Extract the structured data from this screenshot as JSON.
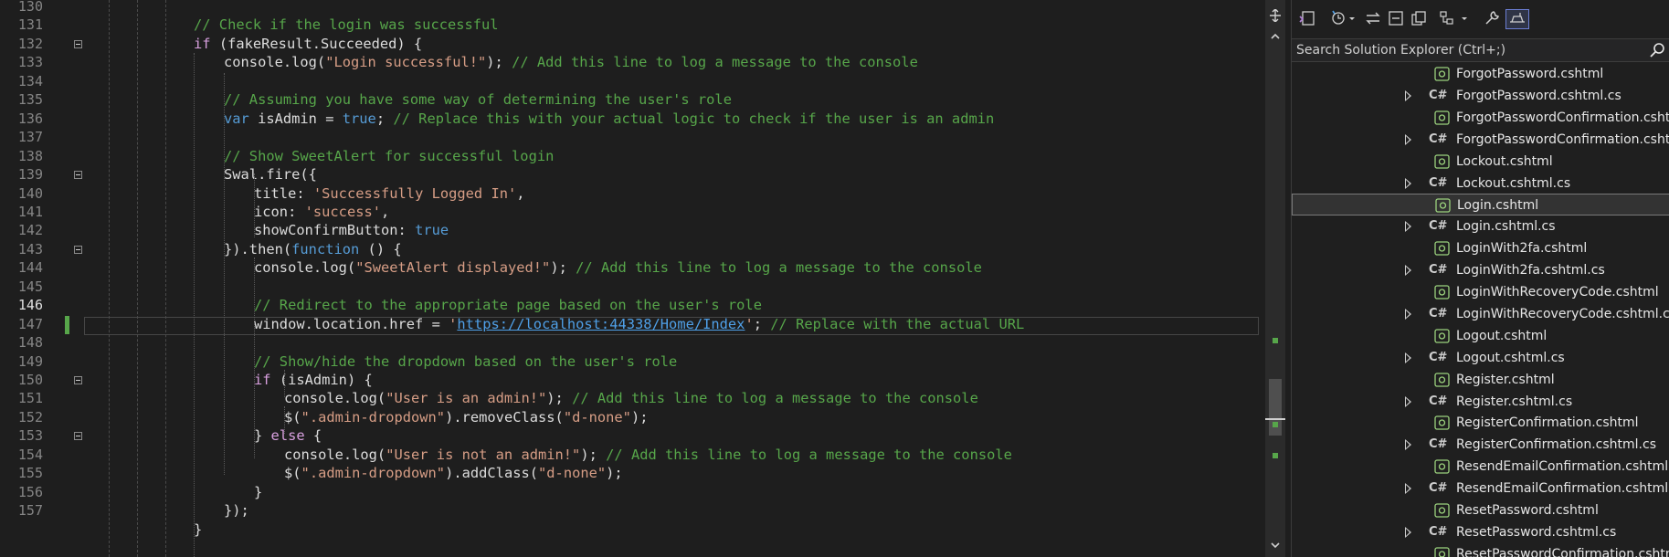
{
  "editor": {
    "line_numbers": [
      "130",
      "131",
      "132",
      "133",
      "134",
      "135",
      "136",
      "137",
      "138",
      "139",
      "140",
      "141",
      "142",
      "143",
      "144",
      "145",
      "146",
      "147",
      "148",
      "149",
      "150",
      "151",
      "152",
      "153",
      "154",
      "155",
      "156",
      "157"
    ],
    "current_line": "146",
    "lines": [
      [],
      [
        {
          "t": "// Check if the login was successful",
          "c": "cm"
        }
      ],
      [
        {
          "t": "if",
          "c": "ct"
        },
        {
          "t": " (fakeResult.Succeeded) {",
          "c": "id"
        }
      ],
      [
        {
          "t": "console.log(",
          "c": "id"
        },
        {
          "t": "\"Login successful!\"",
          "c": "str"
        },
        {
          "t": "); ",
          "c": "id"
        },
        {
          "t": "// Add this line to log a message to the console",
          "c": "cm"
        }
      ],
      [],
      [
        {
          "t": "// Assuming you have some way of determining the user's role",
          "c": "cm"
        }
      ],
      [
        {
          "t": "var",
          "c": "kw"
        },
        {
          "t": " isAdmin = ",
          "c": "id"
        },
        {
          "t": "true",
          "c": "kw"
        },
        {
          "t": "; ",
          "c": "id"
        },
        {
          "t": "// Replace this with your actual logic to check if the user is an admin",
          "c": "cm"
        }
      ],
      [],
      [
        {
          "t": "// Show SweetAlert for successful login",
          "c": "cm"
        }
      ],
      [
        {
          "t": "Swal.fire({",
          "c": "id"
        }
      ],
      [
        {
          "t": "title: ",
          "c": "id"
        },
        {
          "t": "'Successfully Logged In'",
          "c": "str"
        },
        {
          "t": ",",
          "c": "id"
        }
      ],
      [
        {
          "t": "icon: ",
          "c": "id"
        },
        {
          "t": "'success'",
          "c": "str"
        },
        {
          "t": ",",
          "c": "id"
        }
      ],
      [
        {
          "t": "showConfirmButton: ",
          "c": "id"
        },
        {
          "t": "true",
          "c": "kw"
        }
      ],
      [
        {
          "t": "}).then(",
          "c": "id"
        },
        {
          "t": "function",
          "c": "kw"
        },
        {
          "t": " () {",
          "c": "id"
        }
      ],
      [
        {
          "t": "console.log(",
          "c": "id"
        },
        {
          "t": "\"SweetAlert displayed!\"",
          "c": "str"
        },
        {
          "t": "); ",
          "c": "id"
        },
        {
          "t": "// Add this line to log a message to the console",
          "c": "cm"
        }
      ],
      [],
      [
        {
          "t": "// Redirect to the appropriate page based on the user's role",
          "c": "cm"
        }
      ],
      [
        {
          "t": "window.location.href = ",
          "c": "id"
        },
        {
          "t": "'",
          "c": "str"
        },
        {
          "t": "https://localhost:44338/Home/Index",
          "c": "url"
        },
        {
          "t": "'",
          "c": "str"
        },
        {
          "t": "; ",
          "c": "id"
        },
        {
          "t": "// Replace with the actual URL",
          "c": "cm"
        }
      ],
      [],
      [
        {
          "t": "// Show/hide the dropdown based on the user's role",
          "c": "cm"
        }
      ],
      [
        {
          "t": "if",
          "c": "ct"
        },
        {
          "t": " (isAdmin) {",
          "c": "id"
        }
      ],
      [
        {
          "t": "console.log(",
          "c": "id"
        },
        {
          "t": "\"User is an admin!\"",
          "c": "str"
        },
        {
          "t": "); ",
          "c": "id"
        },
        {
          "t": "// Add this line to log a message to the console",
          "c": "cm"
        }
      ],
      [
        {
          "t": "$(",
          "c": "id"
        },
        {
          "t": "\".admin-dropdown\"",
          "c": "str"
        },
        {
          "t": ").removeClass(",
          "c": "id"
        },
        {
          "t": "\"d-none\"",
          "c": "str"
        },
        {
          "t": ");",
          "c": "id"
        }
      ],
      [
        {
          "t": "} ",
          "c": "id"
        },
        {
          "t": "else",
          "c": "ct"
        },
        {
          "t": " {",
          "c": "id"
        }
      ],
      [
        {
          "t": "console.log(",
          "c": "id"
        },
        {
          "t": "\"User is not an admin!\"",
          "c": "str"
        },
        {
          "t": "); ",
          "c": "id"
        },
        {
          "t": "// Add this line to log a message to the console",
          "c": "cm"
        }
      ],
      [
        {
          "t": "$(",
          "c": "id"
        },
        {
          "t": "\".admin-dropdown\"",
          "c": "str"
        },
        {
          "t": ").addClass(",
          "c": "id"
        },
        {
          "t": "\"d-none\"",
          "c": "str"
        },
        {
          "t": ");",
          "c": "id"
        }
      ],
      [
        {
          "t": "}",
          "c": "id"
        }
      ],
      [
        {
          "t": "});",
          "c": "id"
        }
      ]
    ],
    "last_partial_line": "}"
  },
  "solution_explorer": {
    "search_placeholder": "Search Solution Explorer (Ctrl+;)",
    "items": [
      {
        "name": "ForgotPassword.cshtml",
        "kind": "cshtml",
        "expandable": false
      },
      {
        "name": "ForgotPassword.cshtml.cs",
        "kind": "cs",
        "expandable": true
      },
      {
        "name": "ForgotPasswordConfirmation.cshtml",
        "kind": "cshtml",
        "expandable": false
      },
      {
        "name": "ForgotPasswordConfirmation.cshtml.cs",
        "kind": "cs",
        "expandable": true
      },
      {
        "name": "Lockout.cshtml",
        "kind": "cshtml",
        "expandable": false
      },
      {
        "name": "Lockout.cshtml.cs",
        "kind": "cs",
        "expandable": true
      },
      {
        "name": "Login.cshtml",
        "kind": "cshtml",
        "expandable": false,
        "selected": true
      },
      {
        "name": "Login.cshtml.cs",
        "kind": "cs",
        "expandable": true
      },
      {
        "name": "LoginWith2fa.cshtml",
        "kind": "cshtml",
        "expandable": false
      },
      {
        "name": "LoginWith2fa.cshtml.cs",
        "kind": "cs",
        "expandable": true
      },
      {
        "name": "LoginWithRecoveryCode.cshtml",
        "kind": "cshtml",
        "expandable": false
      },
      {
        "name": "LoginWithRecoveryCode.cshtml.cs",
        "kind": "cs",
        "expandable": true
      },
      {
        "name": "Logout.cshtml",
        "kind": "cshtml",
        "expandable": false
      },
      {
        "name": "Logout.cshtml.cs",
        "kind": "cs",
        "expandable": true
      },
      {
        "name": "Register.cshtml",
        "kind": "cshtml",
        "expandable": false
      },
      {
        "name": "Register.cshtml.cs",
        "kind": "cs",
        "expandable": true
      },
      {
        "name": "RegisterConfirmation.cshtml",
        "kind": "cshtml",
        "expandable": false
      },
      {
        "name": "RegisterConfirmation.cshtml.cs",
        "kind": "cs",
        "expandable": true
      },
      {
        "name": "ResendEmailConfirmation.cshtml",
        "kind": "cshtml",
        "expandable": false
      },
      {
        "name": "ResendEmailConfirmation.cshtml.cs",
        "kind": "cs",
        "expandable": true
      },
      {
        "name": "ResetPassword.cshtml",
        "kind": "cshtml",
        "expandable": false
      },
      {
        "name": "ResetPassword.cshtml.cs",
        "kind": "cs",
        "expandable": true
      },
      {
        "name": "ResetPasswordConfirmation.cshtml",
        "kind": "cshtml",
        "expandable": false
      }
    ],
    "cs_icon_label": "C#"
  },
  "colors": {
    "comment": "#57a64a",
    "keyword": "#569cd6",
    "control": "#d8a0df",
    "string": "#d69d85",
    "url": "#4fa0e8",
    "accent": "#6b7ed4"
  }
}
